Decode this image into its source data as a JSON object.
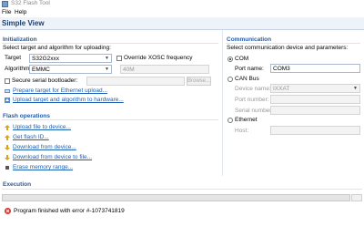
{
  "window": {
    "title": "S32 Flash Tool"
  },
  "menu": {
    "items": [
      "File",
      "Help"
    ]
  },
  "view": {
    "title": "Simple View"
  },
  "init": {
    "heading": "Initialization",
    "subtitle": "Select target and algorithm for uploading:",
    "target_label": "Target",
    "target_value": "S32G2xxx",
    "override_label": "Override XOSC frequency",
    "algorithm_label": "Algorithm",
    "algorithm_value": "EMMC",
    "freq_value": "40M",
    "secure_label": "Secure serial bootloader:",
    "browse_label": "Browse...",
    "link_ethernet": "Prepare target for Ethernet upload...",
    "link_upload_hw": "Upload target and algorithm to hardware..."
  },
  "comm": {
    "heading": "Communication",
    "subtitle": "Select communication device and parameters:",
    "com_label": "COM",
    "port_label": "Port name:",
    "port_value": "COM3",
    "can_label": "CAN Bus",
    "device_label": "Device name:",
    "device_value": "IXXAT",
    "port_number_label": "Port number:",
    "serial_label": "Serial number:",
    "ethernet_label": "Ethernet",
    "host_label": "Host:"
  },
  "flash": {
    "heading": "Flash operations",
    "ops": [
      {
        "label": "Upload file to device...",
        "icon": "upload-icon"
      },
      {
        "label": "Get flash ID...",
        "icon": "flash-id-icon"
      },
      {
        "label": "Download from device...",
        "icon": "download-icon"
      },
      {
        "label": "Download from device to file...",
        "icon": "download-file-icon"
      },
      {
        "label": "Erase memory range...",
        "icon": "erase-icon"
      }
    ]
  },
  "execution": {
    "heading": "Execution",
    "error_text": "Program finished with error #-1073741819"
  },
  "colors": {
    "accent": "#2c5aa0",
    "link": "#1a5fb4",
    "error": "#d9342b"
  }
}
